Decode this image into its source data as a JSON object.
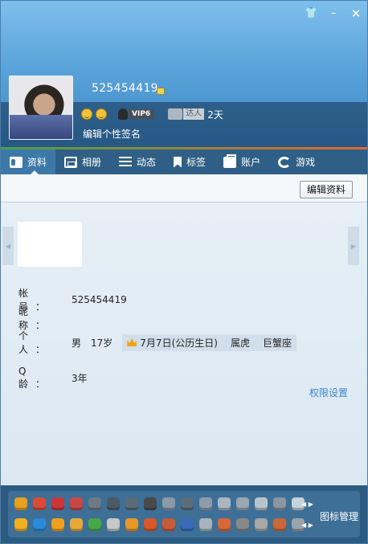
{
  "window": {
    "skin_icon": "shirt-icon",
    "minimize_icon": "minimize-icon",
    "close_icon": "close-icon"
  },
  "profile": {
    "qq_number": "525454419",
    "vip_label": "VIP6",
    "daren_label": "达人",
    "daren_days": "2天",
    "signature_placeholder": "编辑个性签名"
  },
  "tabs": [
    {
      "label": "资料",
      "icon": "profile-card-icon",
      "active": true
    },
    {
      "label": "相册",
      "icon": "photo-album-icon"
    },
    {
      "label": "动态",
      "icon": "feed-list-icon"
    },
    {
      "label": "标签",
      "icon": "bookmark-icon"
    },
    {
      "label": "账户",
      "icon": "wallet-icon"
    },
    {
      "label": "游戏",
      "icon": "game-icon"
    }
  ],
  "toolbar": {
    "edit_button": "编辑资料"
  },
  "details": {
    "account_label": "帐号：",
    "account_value": "525454419",
    "nickname_label": "昵称：",
    "nickname_value": "",
    "personal_label": "个人：",
    "gender": "男",
    "age": "17岁",
    "birthday": "7月7日(公历生日)",
    "zodiac": "属虎",
    "constellation": "巨蟹座",
    "qage_label": "Q龄：",
    "qage_value": "3年"
  },
  "permissions_link": "权限设置",
  "bottom": {
    "icon_manage_label": "图标管理",
    "service_icon_colors_row1": [
      "#e8a020",
      "#d84a3a",
      "#c83838",
      "#c84848",
      "#6c7a86",
      "#4c5a66",
      "#5a6a76",
      "#4a4a4a",
      "#8a9aa6",
      "#5c6c78",
      "#8c9ca8",
      "#aab6c0",
      "#9aa6b0",
      "#b8c4cc",
      "#8a96a0",
      "#c8d2da"
    ],
    "service_icon_colors_row2": [
      "#f0b020",
      "#2a8ad8",
      "#f0a020",
      "#e8a838",
      "#48a848",
      "#c8c8c8",
      "#e89828",
      "#d85828",
      "#c85a3a",
      "#3a6ab8",
      "#a8b4bc",
      "#d8683a",
      "#888",
      "#a8a8a8",
      "#c86838",
      "#9aa4ac"
    ]
  }
}
